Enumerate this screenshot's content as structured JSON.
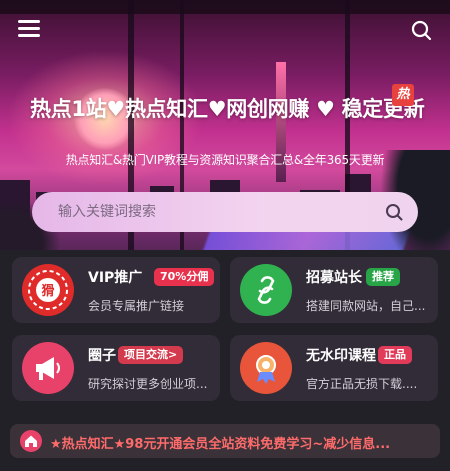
{
  "headline": {
    "title": "热点1站♥热点知汇♥网创网赚 ♥ 稳定更新",
    "badge": "热",
    "subtitle": "热点知汇&热门VIP教程与资源知识聚合汇总&全年365天更新"
  },
  "search": {
    "placeholder": "输入关键词搜索"
  },
  "cards": [
    {
      "title": "VIP推广",
      "tag": "70%分佣",
      "tag_color": "#e8324d",
      "desc": "会员专属推广链接",
      "icon": "stamp-icon",
      "icon_text": "猾"
    },
    {
      "title": "招募站长",
      "tag": "推荐",
      "tag_color": "#27a547",
      "desc": "搭建同款网站，自己...",
      "icon": "link-icon"
    },
    {
      "title": "圈子",
      "tag": "项目交流>",
      "tag_color": "#d43a4d",
      "desc": "研究探讨更多创业项...",
      "icon": "megaphone-icon"
    },
    {
      "title": "无水印课程",
      "tag": "正品",
      "tag_color": "#e23b5a",
      "desc": "官方正品无损下载....",
      "icon": "badge-icon"
    }
  ],
  "marquee": {
    "text": "★热点知汇★98元开通会员全站资料免费学习~减少信息...",
    "icon": "home-icon"
  },
  "colors": {
    "accent_pink": "#e8426a",
    "card_bg": "#342e3a",
    "marquee_text": "#ff6b6b"
  }
}
